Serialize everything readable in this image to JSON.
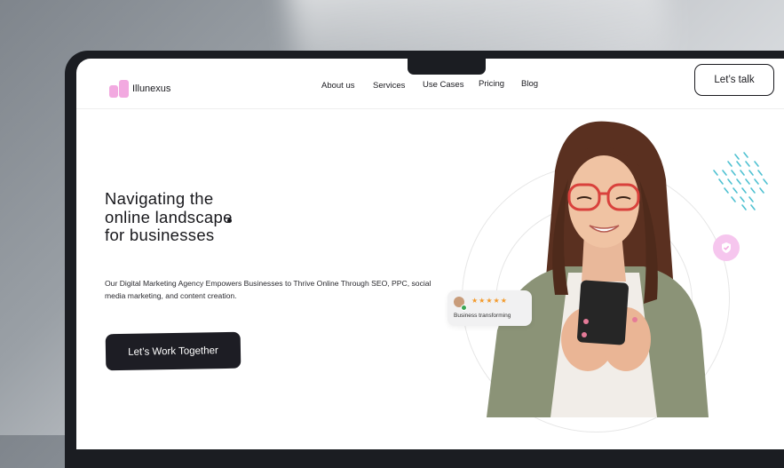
{
  "brand": {
    "name": "Illunexus",
    "logo_icon": "illunexus-logo-icon",
    "accent_color": "#f2a9e0"
  },
  "nav": {
    "items": [
      {
        "label": "About us"
      },
      {
        "label": "Services"
      },
      {
        "label": "Use Cases"
      },
      {
        "label": "Pricing"
      },
      {
        "label": "Blog"
      }
    ],
    "cta_label": "Let’s talk"
  },
  "hero": {
    "title_lines": [
      "Navigating the",
      "online landscape",
      "for businesses"
    ],
    "description": "Our Digital Marketing Agency Empowers Businesses to Thrive Online Through SEO, PPC, social media marketing, and content creation.",
    "cta_label": "Let’s Work Together"
  },
  "review_card": {
    "stars": "★★★★★",
    "rating": 5,
    "text": "Business transforming"
  },
  "colors": {
    "dark": "#1d1d24",
    "star": "#f39a2b",
    "badge_pink": "#f6c6ee",
    "dash_teal": "#4fc1d1"
  },
  "icons": [
    "illunexus-logo-icon",
    "shield-check-icon",
    "star-icon",
    "avatar-icon"
  ]
}
